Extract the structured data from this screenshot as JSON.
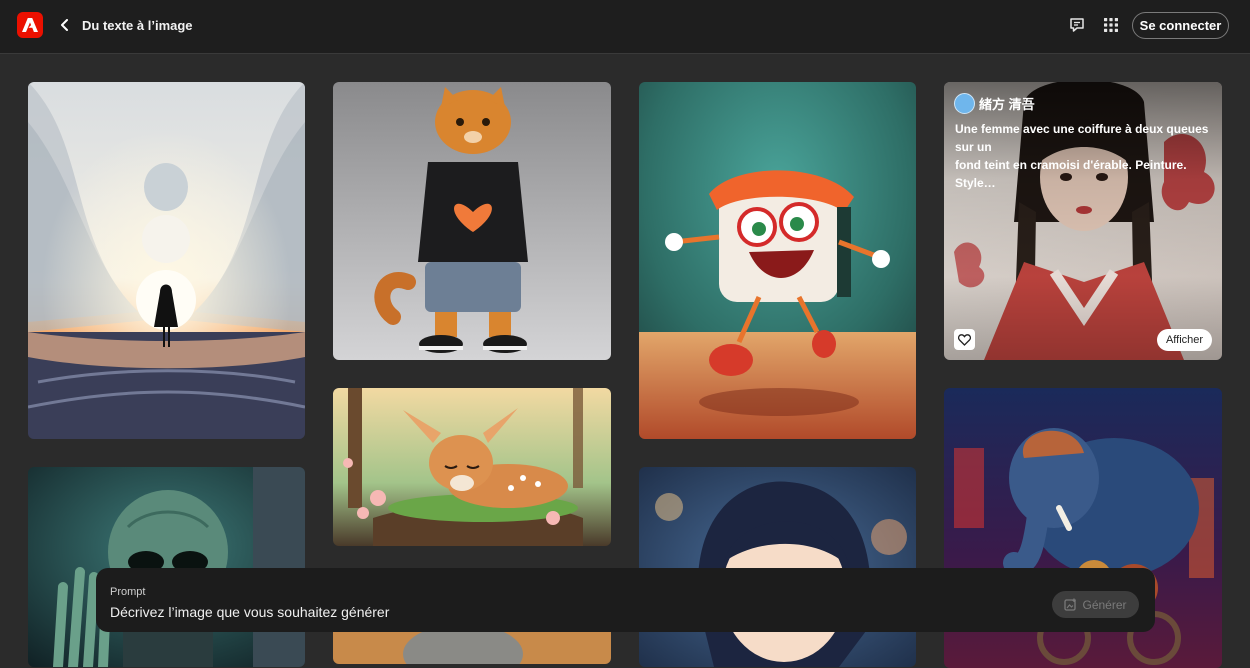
{
  "header": {
    "title": "Du texte à l’image",
    "signin_label": "Se connecter",
    "icons": [
      "adobe-logo",
      "back-chevron",
      "feedback-icon",
      "apps-grid-icon"
    ]
  },
  "gallery": {
    "featured": {
      "author": "緒方 清吾",
      "description_line1": "Une femme avec une coiffure à deux queues sur un",
      "description_line2": "fond teint en cramoisi d'érable. Peinture. Style…",
      "view_label": "Afficher"
    },
    "cards": [
      {
        "subject": "woman-silhouette-surreal-waves"
      },
      {
        "subject": "orange-cat-heart-tshirt"
      },
      {
        "subject": "happy-sushi-character"
      },
      {
        "subject": "woman-twin-braids-crimson"
      },
      {
        "subject": "sleeping-fawn-forest"
      },
      {
        "subject": "alien-portrait"
      },
      {
        "subject": "anime-girl-rain"
      },
      {
        "subject": "steampunk-elephant-neon"
      }
    ]
  },
  "prompt": {
    "label": "Prompt",
    "placeholder": "Décrivez l’image que vous souhaitez générer",
    "generate_label": "Générer"
  },
  "colors": {
    "brand_red": "#eb1000",
    "header_bg": "#1e1e1e",
    "page_bg": "#2b2b2b",
    "prompt_bg": "#1c1c1c"
  }
}
